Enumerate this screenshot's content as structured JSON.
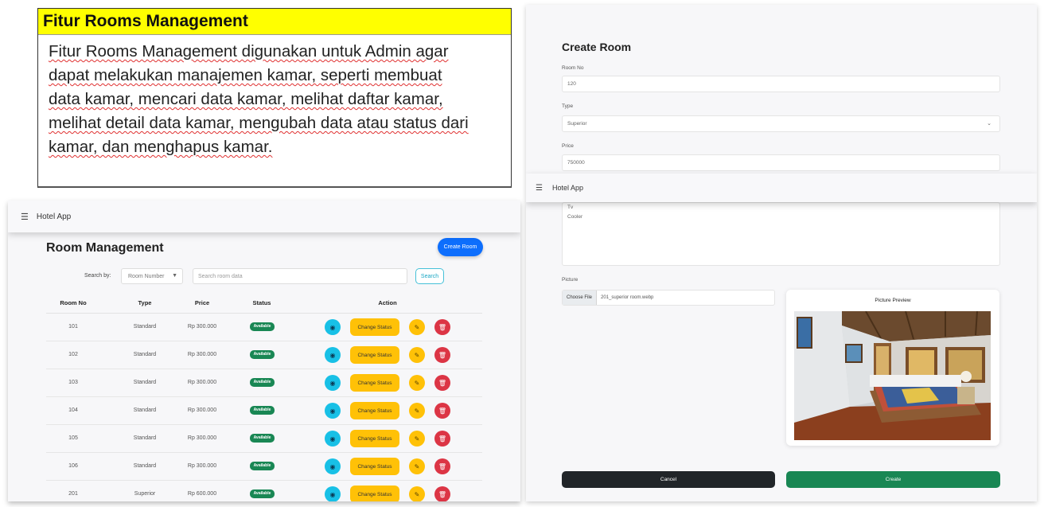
{
  "doc": {
    "title": "Fitur Rooms Management",
    "lines": [
      "Fitur Rooms Management  digunakan untuk Admin agar",
      "dapat melakukan  manajemen  kamar,  seperti membuat",
      "data kamar,  mencari data kamar,  melihat  daftar kamar,",
      "melihat  detail data kamar,  mengubah  data atau status dari",
      "kamar,  dan menghapus  kamar."
    ]
  },
  "left": {
    "navbar": {
      "menu_icon": "hamburger-icon",
      "app_name": "Hotel App"
    },
    "title": "Room Management",
    "create_button": "Create Room",
    "search": {
      "label": "Search by:",
      "select_value": "Room Number",
      "input_placeholder": "Search room data",
      "button": "Search"
    },
    "table": {
      "headers": [
        "Room No",
        "Type",
        "Price",
        "Status",
        "Action"
      ],
      "rows": [
        {
          "room_no": "101",
          "type": "Standard",
          "price": "Rp 300.000",
          "status": "Available",
          "action": "Change Status"
        },
        {
          "room_no": "102",
          "type": "Standard",
          "price": "Rp 300.000",
          "status": "Available",
          "action": "Change Status"
        },
        {
          "room_no": "103",
          "type": "Standard",
          "price": "Rp 300.000",
          "status": "Available",
          "action": "Change Status"
        },
        {
          "room_no": "104",
          "type": "Standard",
          "price": "Rp 300.000",
          "status": "Available",
          "action": "Change Status"
        },
        {
          "room_no": "105",
          "type": "Standard",
          "price": "Rp 300.000",
          "status": "Available",
          "action": "Change Status"
        },
        {
          "room_no": "106",
          "type": "Standard",
          "price": "Rp 300.000",
          "status": "Available",
          "action": "Change Status"
        },
        {
          "room_no": "201",
          "type": "Superior",
          "price": "Rp 600.000",
          "status": "Available",
          "action": "Change Status"
        }
      ]
    },
    "icons": {
      "view": "view-icon",
      "edit": "pencil-icon",
      "delete": "trash-icon"
    },
    "colors": {
      "primary": "#0d6efd",
      "success": "#198754",
      "warning": "#ffc107",
      "danger": "#dc3545",
      "info": "#18c0e6"
    }
  },
  "right": {
    "title": "Create Room",
    "room_no": {
      "label": "Room No",
      "value": "120"
    },
    "type": {
      "label": "Type",
      "value": "Superior"
    },
    "price": {
      "label": "Price",
      "value": "750000"
    },
    "navbar": {
      "menu_icon": "hamburger-icon",
      "app_name": "Hotel App"
    },
    "description_value": "Tv\nCooler",
    "picture": {
      "label": "Picture",
      "file_button": "Choose File",
      "file_name": "201_superior room.webp",
      "preview_title": "Picture Preview"
    },
    "cancel_button": "Cancel",
    "create_button": "Create",
    "colors": {
      "dark": "#212529",
      "success": "#198754"
    }
  }
}
